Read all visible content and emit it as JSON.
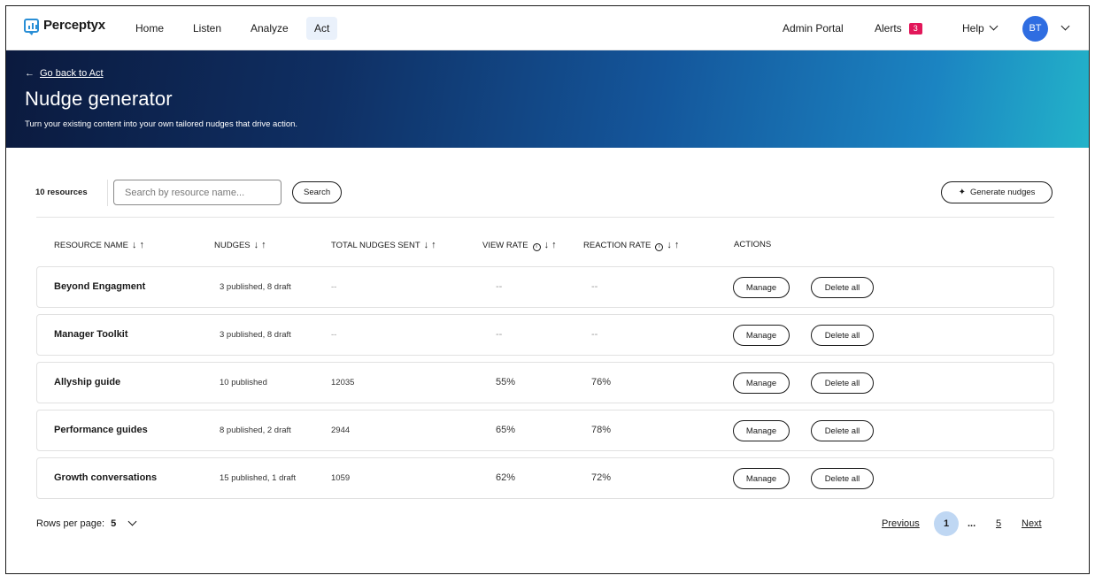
{
  "nav": {
    "brand": "Perceptyx",
    "items": [
      "Home",
      "Listen",
      "Analyze",
      "Act"
    ],
    "active": "Act",
    "admin_portal": "Admin Portal",
    "alerts_label": "Alerts",
    "alerts_count": "3",
    "help_label": "Help",
    "avatar_initials": "BT"
  },
  "hero": {
    "back_link": "Go back to Act",
    "title": "Nudge generator",
    "subtitle": "Turn your existing content into your own tailored nudges that drive action."
  },
  "toolbar": {
    "resource_count": "10 resources",
    "search_placeholder": "Search by resource name...",
    "search_button": "Search",
    "generate_button": "Generate nudges"
  },
  "table": {
    "columns": [
      "RESOURCE NAME",
      "NUDGES",
      "TOTAL NUDGES SENT",
      "VIEW RATE",
      "REACTION RATE",
      "ACTIONS"
    ],
    "manage_label": "Manage",
    "delete_label": "Delete all",
    "rows": [
      {
        "name": "Beyond Engagment",
        "nudges": "3 published, 8 draft",
        "sent": "--",
        "view": "--",
        "reaction": "--"
      },
      {
        "name": "Manager Toolkit",
        "nudges": "3 published, 8 draft",
        "sent": "--",
        "view": "--",
        "reaction": "--"
      },
      {
        "name": "Allyship guide",
        "nudges": "10 published",
        "sent": "12035",
        "view": "55%",
        "reaction": "76%"
      },
      {
        "name": "Performance guides",
        "nudges": "8 published, 2 draft",
        "sent": "2944",
        "view": "65%",
        "reaction": "78%"
      },
      {
        "name": "Growth conversations",
        "nudges": "15 published, 1 draft",
        "sent": "1059",
        "view": "62%",
        "reaction": "72%"
      }
    ]
  },
  "pagination": {
    "rows_per_page_label": "Rows per page:",
    "rows_per_page_value": "5",
    "previous": "Previous",
    "current": "1",
    "ellipsis": "...",
    "last": "5",
    "next": "Next"
  },
  "colors": {
    "accent": "#2f6de1",
    "alert_badge": "#e2175a",
    "current_page": "#bfd7f3"
  }
}
